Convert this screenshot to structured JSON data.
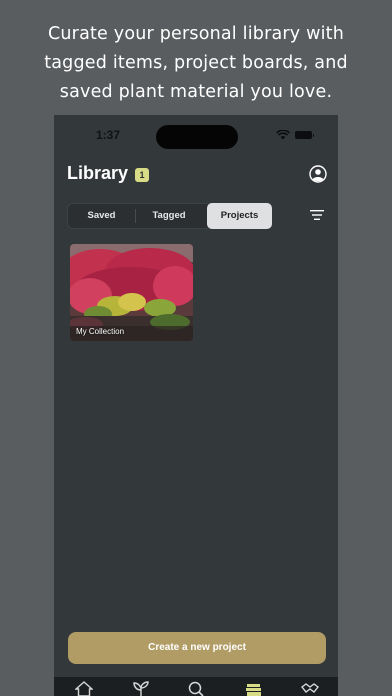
{
  "caption": {
    "line1": "Curate your personal library with",
    "line2": "tagged items, project boards, and",
    "line3": "saved plant material you love."
  },
  "status_bar": {
    "time": "1:37"
  },
  "header": {
    "title": "Library",
    "badge": "1"
  },
  "tabs": [
    {
      "label": "Saved",
      "selected": false
    },
    {
      "label": "Tagged",
      "selected": false
    },
    {
      "label": "Projects",
      "selected": true
    }
  ],
  "projects": [
    {
      "label": "My Collection"
    }
  ],
  "create_button": {
    "label": "Create a new project"
  },
  "tab_bar": [
    "home-icon",
    "plant-icon",
    "search-icon",
    "library-icon",
    "handshake-icon"
  ],
  "colors": {
    "background": "#595d60",
    "screen": "#33383b",
    "accent_gold": "#b29c66",
    "badge": "#d9dc86",
    "active_tab_icon": "#d9dc86"
  }
}
